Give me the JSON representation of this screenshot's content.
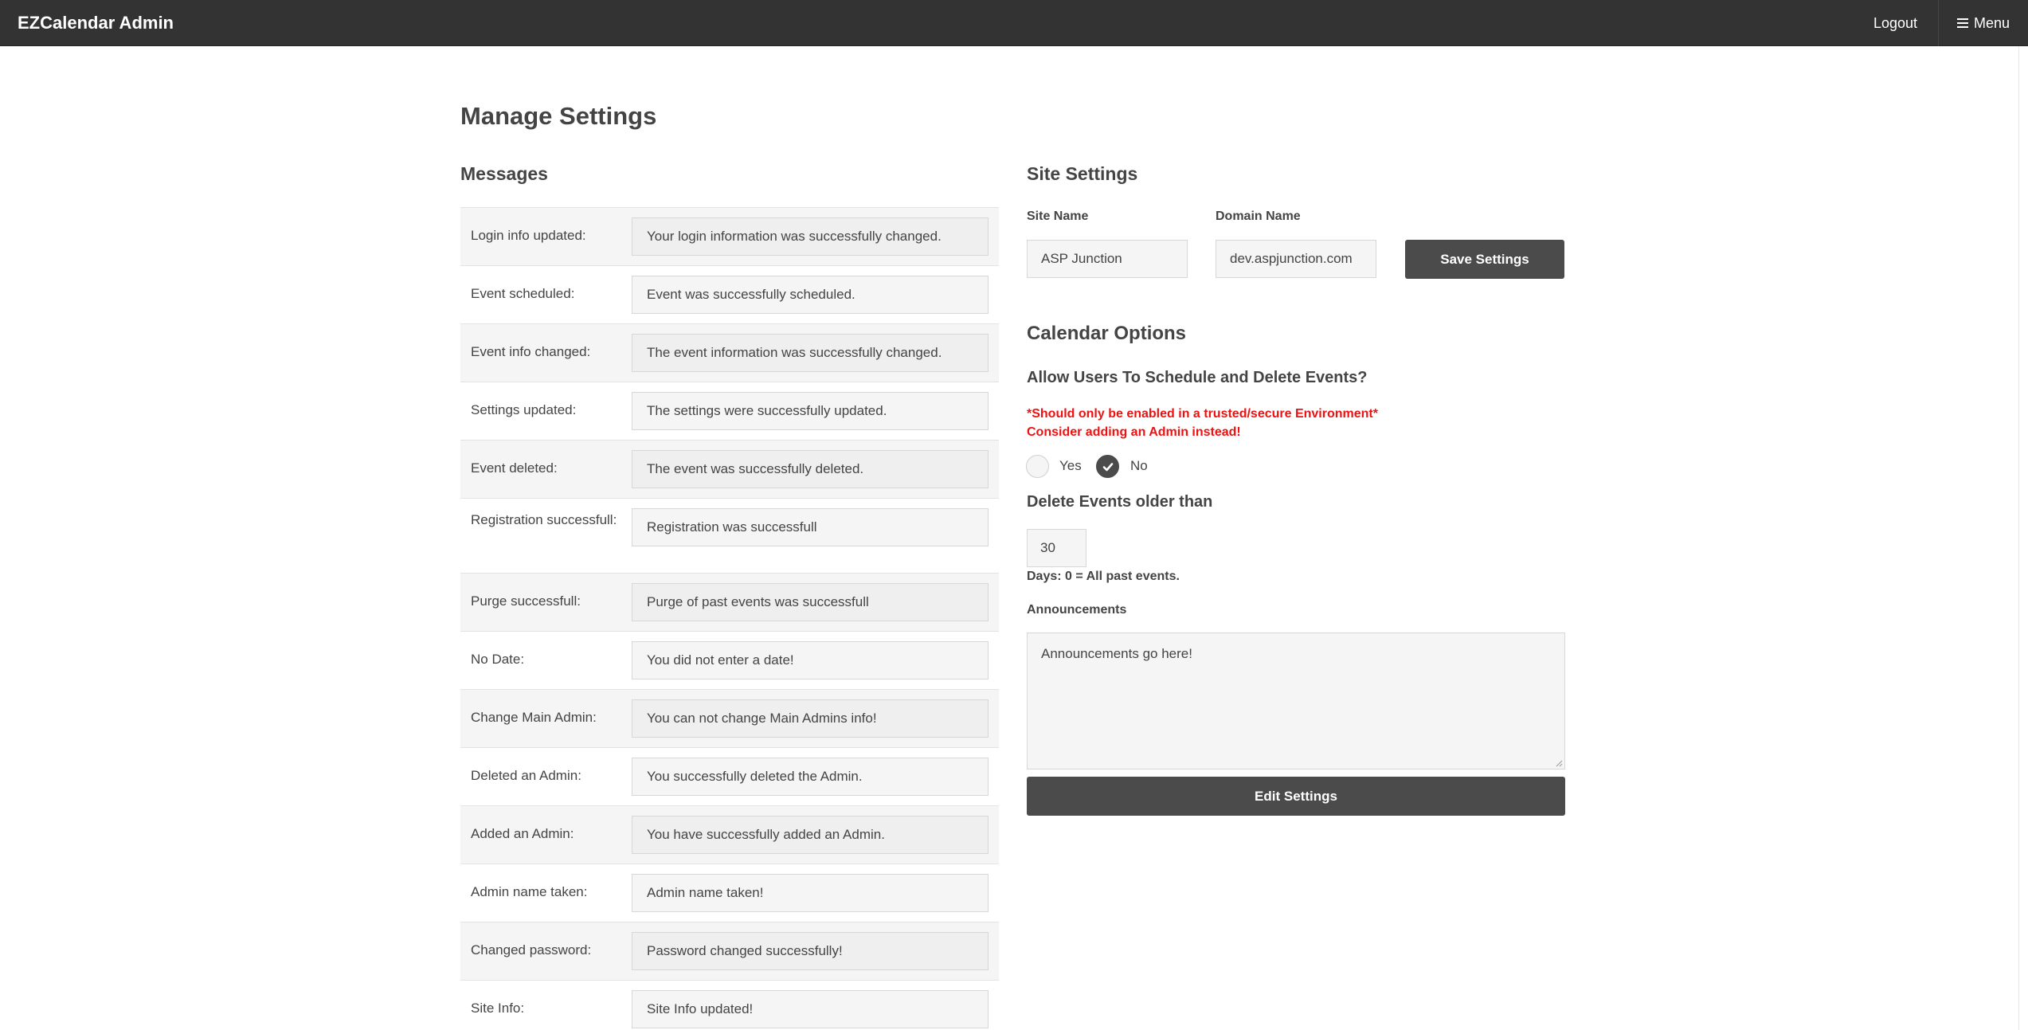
{
  "navbar": {
    "brand": "EZCalendar Admin",
    "logout_label": "Logout",
    "menu_label": "Menu"
  },
  "page": {
    "title": "Manage Settings"
  },
  "messages": {
    "title": "Messages",
    "rows": [
      {
        "label": "Login info updated:",
        "value": "Your login information was successfully changed."
      },
      {
        "label": "Event scheduled:",
        "value": "Event was successfully scheduled."
      },
      {
        "label": "Event info changed:",
        "value": "The event information was successfully changed."
      },
      {
        "label": "Settings updated:",
        "value": "The settings were successfully updated."
      },
      {
        "label": "Event deleted:",
        "value": "The event was successfully deleted."
      },
      {
        "label": "Registration successfull:",
        "value": "Registration was successfull"
      },
      {
        "label": "Purge successfull:",
        "value": "Purge of past events was successfull"
      },
      {
        "label": "No Date:",
        "value": "You did not enter a date!"
      },
      {
        "label": "Change Main Admin:",
        "value": "You can not change Main Admins info!"
      },
      {
        "label": "Deleted an Admin:",
        "value": "You successfully deleted the Admin."
      },
      {
        "label": "Added an Admin:",
        "value": "You have successfully added an Admin."
      },
      {
        "label": "Admin name taken:",
        "value": "Admin name taken!"
      },
      {
        "label": "Changed password:",
        "value": "Password changed successfully!"
      },
      {
        "label": "Site Info:",
        "value": "Site Info updated!"
      }
    ]
  },
  "site_settings": {
    "title": "Site Settings",
    "site_name_label": "Site Name",
    "site_name_value": "ASP Junction",
    "domain_name_label": "Domain Name",
    "domain_name_value": "dev.aspjunction.com",
    "save_button": "Save Settings"
  },
  "calendar_options": {
    "title": "Calendar Options",
    "question": "Allow Users To Schedule and Delete Events?",
    "warning_line1": "*Should only be enabled in a trusted/secure Environment*",
    "warning_line2": "Consider adding an Admin instead!",
    "yes_label": "Yes",
    "no_label": "No",
    "selected": "No",
    "delete_label": "Delete Events older than",
    "delete_days": "30",
    "days_hint": "Days: 0 = All past events.",
    "announcements_label": "Announcements",
    "announcements_value": "Announcements go here!",
    "edit_button": "Edit Settings"
  },
  "colors": {
    "navbar": "#333333",
    "button": "#4b4b4b",
    "warning": "#ee1111",
    "input_bg": "#f5f5f5"
  }
}
